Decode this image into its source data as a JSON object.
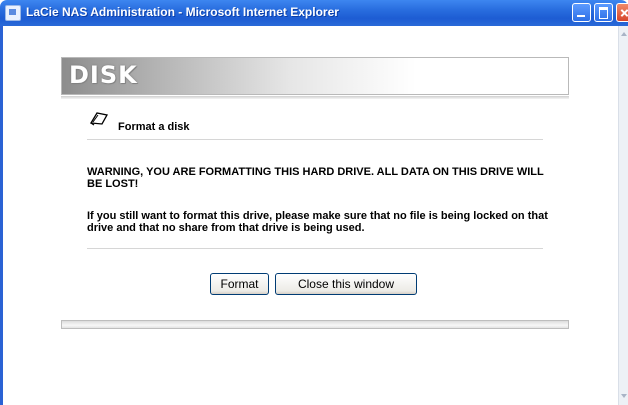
{
  "window": {
    "title": "LaCie NAS Administration - Microsoft Internet Explorer",
    "icon": "ie-page-icon"
  },
  "page": {
    "header_title": "DISK",
    "section_title": "Format a disk",
    "section_icon": "pencil-note-icon",
    "warning": "WARNING, YOU ARE FORMATTING THIS HARD DRIVE. ALL DATA ON THIS DRIVE WILL BE LOST!",
    "info": "If you still want to format this drive, please make sure that no file is being locked on that drive and that no share from that drive is being used."
  },
  "buttons": {
    "format_label": "Format",
    "close_label": "Close this window"
  },
  "colors": {
    "titlebar": "#2a6fe0",
    "close_button": "#d6452a"
  }
}
